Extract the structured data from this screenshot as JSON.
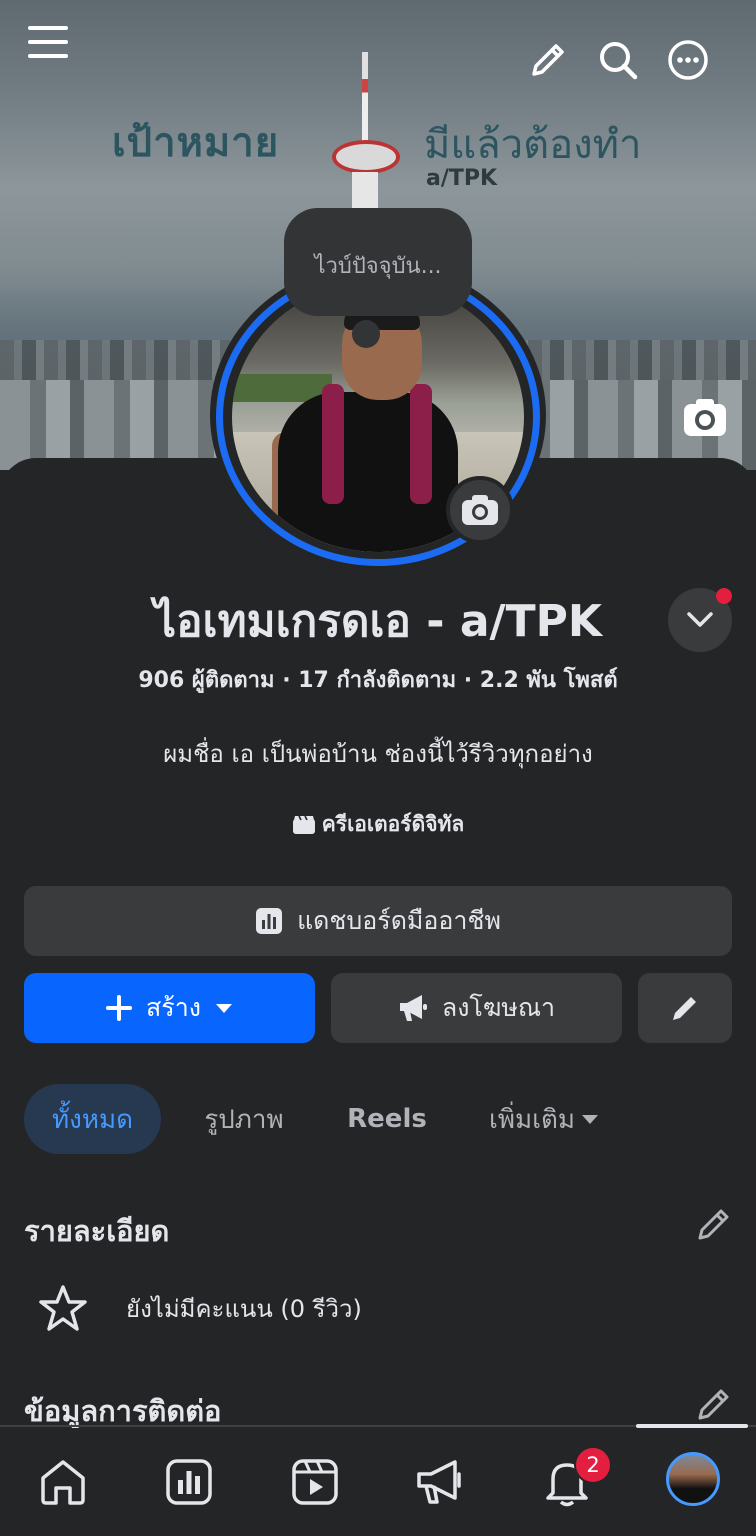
{
  "cover": {
    "text_left": "เป้าหมาย",
    "text_right": "มีแล้วต้องทำ",
    "tag": "a/TPK"
  },
  "top_icons": [
    "menu-icon",
    "pencil-icon",
    "search-icon",
    "more-icon"
  ],
  "note_bubble": {
    "text": "ไวบ์ปัจจุบัน..."
  },
  "profile": {
    "name": "ไอเทมเกรดเอ - a/TPK",
    "stats": "906 ผู้ติดตาม · 17 กำลังติดตาม · 2.2 พัน โพสต์",
    "bio": "ผมชื่อ เอ เป็นพ่อบ้าน ช่องนี้ไว้รีวิวทุกอย่าง",
    "category": "ครีเอเตอร์ดิจิทัล"
  },
  "buttons": {
    "dashboard": "แดชบอร์ดมืออาชีพ",
    "create": "สร้าง",
    "advertise": "ลงโฆษณา"
  },
  "tabs": {
    "all": "ทั้งหมด",
    "photos": "รูปภาพ",
    "reels": "Reels",
    "more": "เพิ่มเติม"
  },
  "details": {
    "title": "รายละเอียด",
    "rating": "ยังไม่มีคะแนน (0 รีวิว)"
  },
  "contact": {
    "title": "ข้อมูลการติดต่อ"
  },
  "nav": {
    "items": [
      "home-icon",
      "dashboard-icon",
      "video-icon",
      "megaphone-icon",
      "notifications-icon",
      "profile-avatar"
    ],
    "notification_badge": "2"
  },
  "colors": {
    "background": "#242526",
    "accent": "#0866ff",
    "tab_active_bg": "#263951",
    "tab_active_text": "#4599ff",
    "badge": "#e41e3f"
  }
}
